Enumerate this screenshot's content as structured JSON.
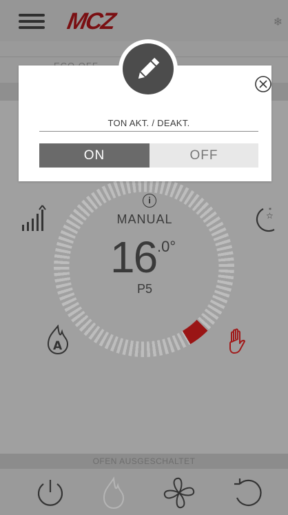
{
  "header": {
    "logo_text": "MCZ",
    "status_icon": "snowflake-icon"
  },
  "subbar": {
    "eco_label": "ECO OFF"
  },
  "dial": {
    "mode": "MANUAL",
    "temperature_integer": "16",
    "temperature_decimal": ".0°",
    "power_level": "P5",
    "accent_color": "#9a1515"
  },
  "icons": {
    "left_top": "signal-strength-icon",
    "right_top": "moon-star-icon",
    "left_bottom": "flame-auto-icon",
    "right_bottom": "hand-icon"
  },
  "status": {
    "text": "OFEN AUSGESCHALTET"
  },
  "bottom_nav": [
    {
      "icon": "power-icon"
    },
    {
      "icon": "flame-icon"
    },
    {
      "icon": "fan-icon"
    },
    {
      "icon": "refresh-icon"
    }
  ],
  "modal": {
    "icon": "pencil-icon",
    "title": "TON AKT. / DEAKT.",
    "option_on": "ON",
    "option_off": "OFF",
    "selected": "ON"
  }
}
